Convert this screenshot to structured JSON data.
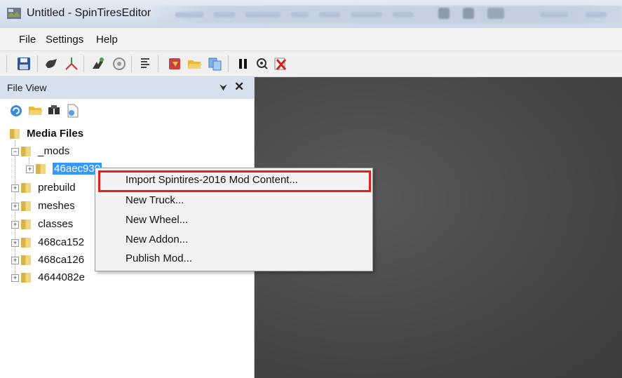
{
  "window": {
    "title": "Untitled - SpinTiresEditor"
  },
  "menu": {
    "items": [
      "File",
      "Settings",
      "Help"
    ]
  },
  "toolbar": {
    "icons": [
      "save-icon",
      "paint-brush-icon",
      "axes-icon",
      "tree-brush-icon",
      "mud-icon",
      "list-icon",
      "import-icon",
      "open-folder-icon",
      "copy-icon",
      "pause-icon",
      "zoom-icon",
      "delete-icon"
    ]
  },
  "file_view": {
    "title": "File View",
    "pin_glyph": "⮟",
    "close_glyph": "✕",
    "tree": {
      "root": "Media Files",
      "mods": "_mods",
      "selected": "46aec930",
      "items": [
        "prebuild",
        "meshes",
        "classes",
        "468ca152",
        "468ca126",
        "4644082e"
      ]
    }
  },
  "context_menu": {
    "items": [
      "Import Spintires-2016 Mod Content...",
      "New Truck...",
      "New Wheel...",
      "New Addon...",
      "Publish Mod..."
    ],
    "highlight_color": "#e02020"
  },
  "colors": {
    "selection": "#3399ff",
    "panel_header": "#d7e1ee",
    "viewport": "#4a4a4a"
  }
}
